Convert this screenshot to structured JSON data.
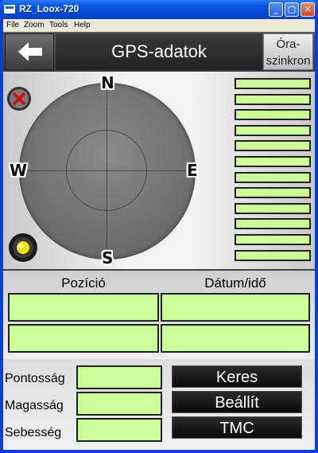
{
  "window": {
    "title": "RZ_Loox-720",
    "menu": [
      "File",
      "Zoom",
      "Tools",
      "Help"
    ],
    "controls": {
      "minimize": "_",
      "maximize": "□",
      "close": "✕"
    }
  },
  "header": {
    "back_icon": "arrow-left-icon",
    "title": "GPS-adatok",
    "clock_sync_line1": "Óra-",
    "clock_sync_line2": "szinkron"
  },
  "compass": {
    "north": "N",
    "south": "S",
    "west": "W",
    "east": "E",
    "status_icon": "no-fix-icon",
    "led_icon": "led-icon",
    "satellite_bar_count": 12
  },
  "position": {
    "col1_header": "Pozíció",
    "col2_header": "Dátum/idő"
  },
  "details": {
    "accuracy_label": "Pontosság",
    "altitude_label": "Magasság",
    "speed_label": "Sebesség"
  },
  "actions": {
    "search": "Keres",
    "settings": "Beállít",
    "tmc": "TMC"
  },
  "colors": {
    "field": "#ccff99",
    "header": "#3a3a3a",
    "button": "#111111"
  }
}
